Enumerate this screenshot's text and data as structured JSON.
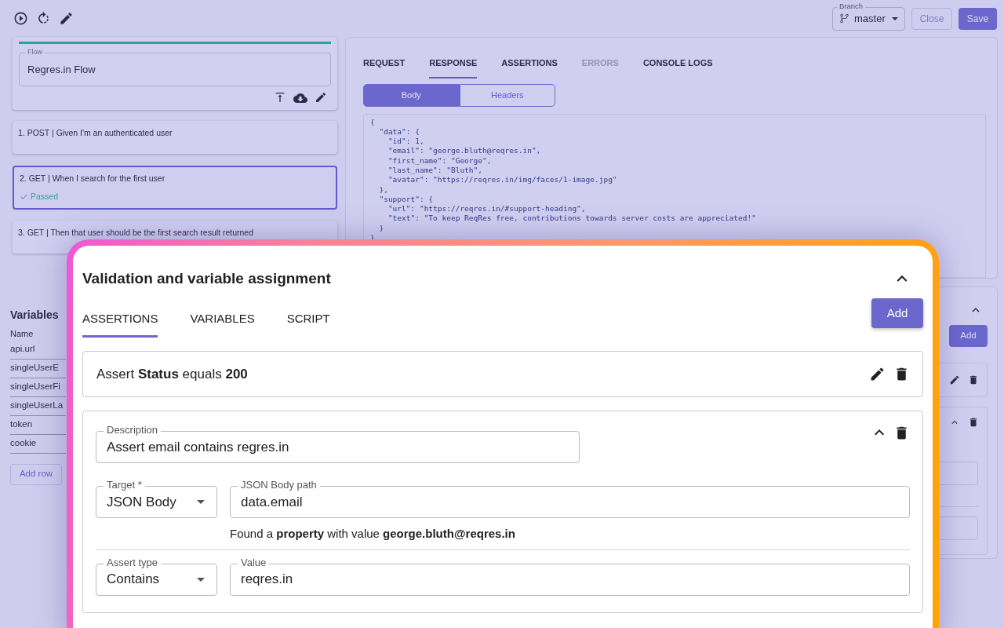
{
  "header": {
    "branch": {
      "label": "Branch",
      "value": "master"
    },
    "close": "Close",
    "save": "Save"
  },
  "flow": {
    "label": "Flow",
    "value": "Regres.in Flow"
  },
  "steps": [
    {
      "label": "1. POST | Given I'm an authenticated user",
      "selected": false
    },
    {
      "label": "2. GET | When I search for the first user",
      "status": "Passed",
      "selected": true
    },
    {
      "label": "3. GET | Then that user should be the first search result returned",
      "selected": false
    }
  ],
  "variables": {
    "title": "Variables",
    "column": "Name",
    "rows": [
      "api.url",
      "singleUserE",
      "singleUserFi",
      "singleUserLa",
      "token",
      "cookie"
    ],
    "add_row": "Add row"
  },
  "response_panel": {
    "tabs": [
      {
        "label": "REQUEST",
        "selected": false,
        "disabled": false
      },
      {
        "label": "RESPONSE",
        "selected": true,
        "disabled": false
      },
      {
        "label": "ASSERTIONS",
        "selected": false,
        "disabled": false
      },
      {
        "label": "ERRORS",
        "selected": false,
        "disabled": true
      },
      {
        "label": "CONSOLE LOGS",
        "selected": false,
        "disabled": false
      }
    ],
    "views": [
      {
        "label": "Body",
        "selected": true
      },
      {
        "label": "Headers",
        "selected": false
      }
    ],
    "code": [
      "{",
      "  \"data\": {",
      "    \"id\": 1,",
      "    \"email\": \"george.bluth@reqres.in\",",
      "    \"first_name\": \"George\",",
      "    \"last_name\": \"Bluth\",",
      "    \"avatar\": \"https://reqres.in/img/faces/1-image.jpg\"",
      "  },",
      "  \"support\": {",
      "    \"url\": \"https://reqres.in/#support-heading\",",
      "    \"text\": \"To keep ReqRes free, contributions towards server costs are appreciated!\"",
      "  }",
      "}"
    ]
  },
  "back_panel": {
    "add": "Add"
  },
  "modal": {
    "title": "Validation and variable assignment",
    "tabs": [
      {
        "label": "ASSERTIONS",
        "selected": true
      },
      {
        "label": "VARIABLES",
        "selected": false
      },
      {
        "label": "SCRIPT",
        "selected": false
      }
    ],
    "add": "Add",
    "assertions": [
      {
        "kind": "summary",
        "text": "Assert **Status** equals **200**"
      },
      {
        "kind": "form",
        "description": {
          "label": "Description",
          "value": "Assert email contains regres.in"
        },
        "target": {
          "label": "Target *",
          "value": "JSON Body"
        },
        "path": {
          "label": "JSON Body path",
          "value": "data.email"
        },
        "hint": "Found a **property** with value **george.bluth@reqres.in**",
        "assert_type": {
          "label": "Assert type",
          "value": "Contains"
        },
        "value": {
          "label": "Value",
          "value": "reqres.in"
        }
      }
    ]
  }
}
